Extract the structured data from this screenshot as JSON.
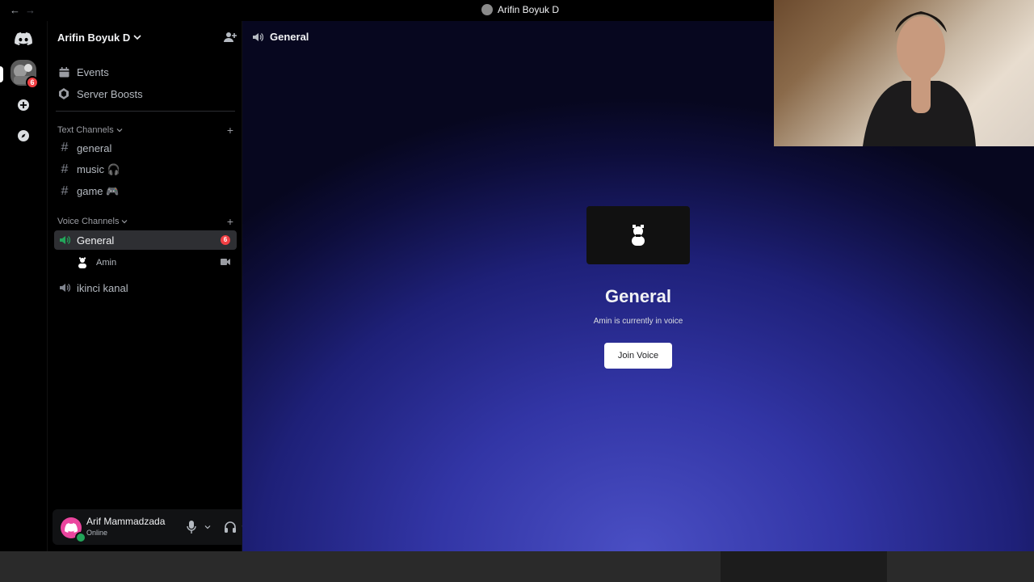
{
  "window": {
    "title": "Arifin Boyuk D",
    "back_glyph": "←",
    "forward_glyph": "→"
  },
  "rail": {
    "server_badge": "6",
    "icons": [
      "discord-home-icon",
      "server-icon",
      "add-server-icon",
      "explore-icon"
    ]
  },
  "server": {
    "name": "Arifin Boyuk D"
  },
  "sidebar": {
    "top_items": [
      {
        "label": "Events",
        "icon": "calendar-icon"
      },
      {
        "label": "Server Boosts",
        "icon": "boost-icon"
      }
    ],
    "text_category": "Text Channels",
    "text_channels": [
      {
        "name": "general"
      },
      {
        "name": "music 🎧"
      },
      {
        "name": "game 🎮"
      }
    ],
    "voice_category": "Voice Channels",
    "voice_channels": [
      {
        "name": "General",
        "count": "6",
        "active": true
      },
      {
        "name": "ikinci kanal"
      }
    ],
    "voice_member": {
      "name": "Amin"
    }
  },
  "user": {
    "name": "Arif Mammadzada",
    "status": "Online",
    "status_color": "#23a55a",
    "avatar_color": "#eb459e"
  },
  "main": {
    "channel_name": "General",
    "voice_title": "General",
    "voice_subtitle": "Amin is currently in voice",
    "join_label": "Join Voice"
  },
  "colors": {
    "accent": "#5865f2",
    "badge": "#f23f43",
    "active_row": "#2e2f33"
  }
}
